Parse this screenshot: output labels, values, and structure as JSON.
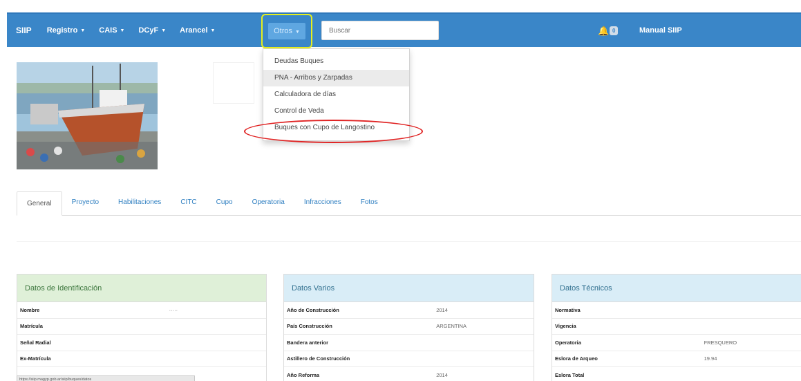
{
  "navbar": {
    "brand": "SIIP",
    "items": [
      {
        "label": "Registro"
      },
      {
        "label": "CAIS"
      },
      {
        "label": "DCyF"
      },
      {
        "label": "Arancel"
      }
    ],
    "otros_label": "Otros",
    "search_placeholder": "Buscar",
    "notification_count": "0",
    "manual_label": "Manual SIIP"
  },
  "dropdown": {
    "items": [
      {
        "label": "Deudas Buques"
      },
      {
        "label": "PNA - Arribos y Zarpadas"
      },
      {
        "label": "Calculadora de días"
      },
      {
        "label": "Control de Veda"
      },
      {
        "label": "Buques con Cupo de Langostino"
      }
    ]
  },
  "tabs": [
    {
      "label": "General"
    },
    {
      "label": "Proyecto"
    },
    {
      "label": "Habilitaciones"
    },
    {
      "label": "CITC"
    },
    {
      "label": "Cupo"
    },
    {
      "label": "Operatoria"
    },
    {
      "label": "Infracciones"
    },
    {
      "label": "Fotos"
    }
  ],
  "panels": {
    "identificacion": {
      "title": "Datos de Identificación",
      "rows": [
        {
          "k": "Nombre",
          "v": "·····"
        },
        {
          "k": "Matrícula",
          "v": ""
        },
        {
          "k": "Señal Radial",
          "v": ""
        },
        {
          "k": "Ex-Matrícula",
          "v": ""
        }
      ]
    },
    "varios": {
      "title": "Datos Varios",
      "rows": [
        {
          "k": "Año de Construcción",
          "v": "2014"
        },
        {
          "k": "País Construcción",
          "v": "ARGENTINA"
        },
        {
          "k": "Bandera anterior",
          "v": ""
        },
        {
          "k": "Astillero de Construcción",
          "v": ""
        },
        {
          "k": "Año Reforma",
          "v": "2014"
        }
      ]
    },
    "tecnicos": {
      "title": "Datos Técnicos",
      "rows": [
        {
          "k": "Normativa",
          "v": ""
        },
        {
          "k": "Vigencia",
          "v": ""
        },
        {
          "k": "Operatoria",
          "v": "FRESQUERO"
        },
        {
          "k": "Eslora de Arqueo",
          "v": "19.94"
        },
        {
          "k": "Eslora Total",
          "v": ""
        }
      ]
    }
  },
  "statusbar_url": "https://siip.magyp.gob.ar/siip/buques/datos",
  "colors": {
    "navbar": "#3a86c8",
    "highlight_box": "#e7ef1d",
    "highlight_ellipse": "#e02424",
    "panel_green": "#dff0d8",
    "panel_blue": "#d9edf7"
  }
}
